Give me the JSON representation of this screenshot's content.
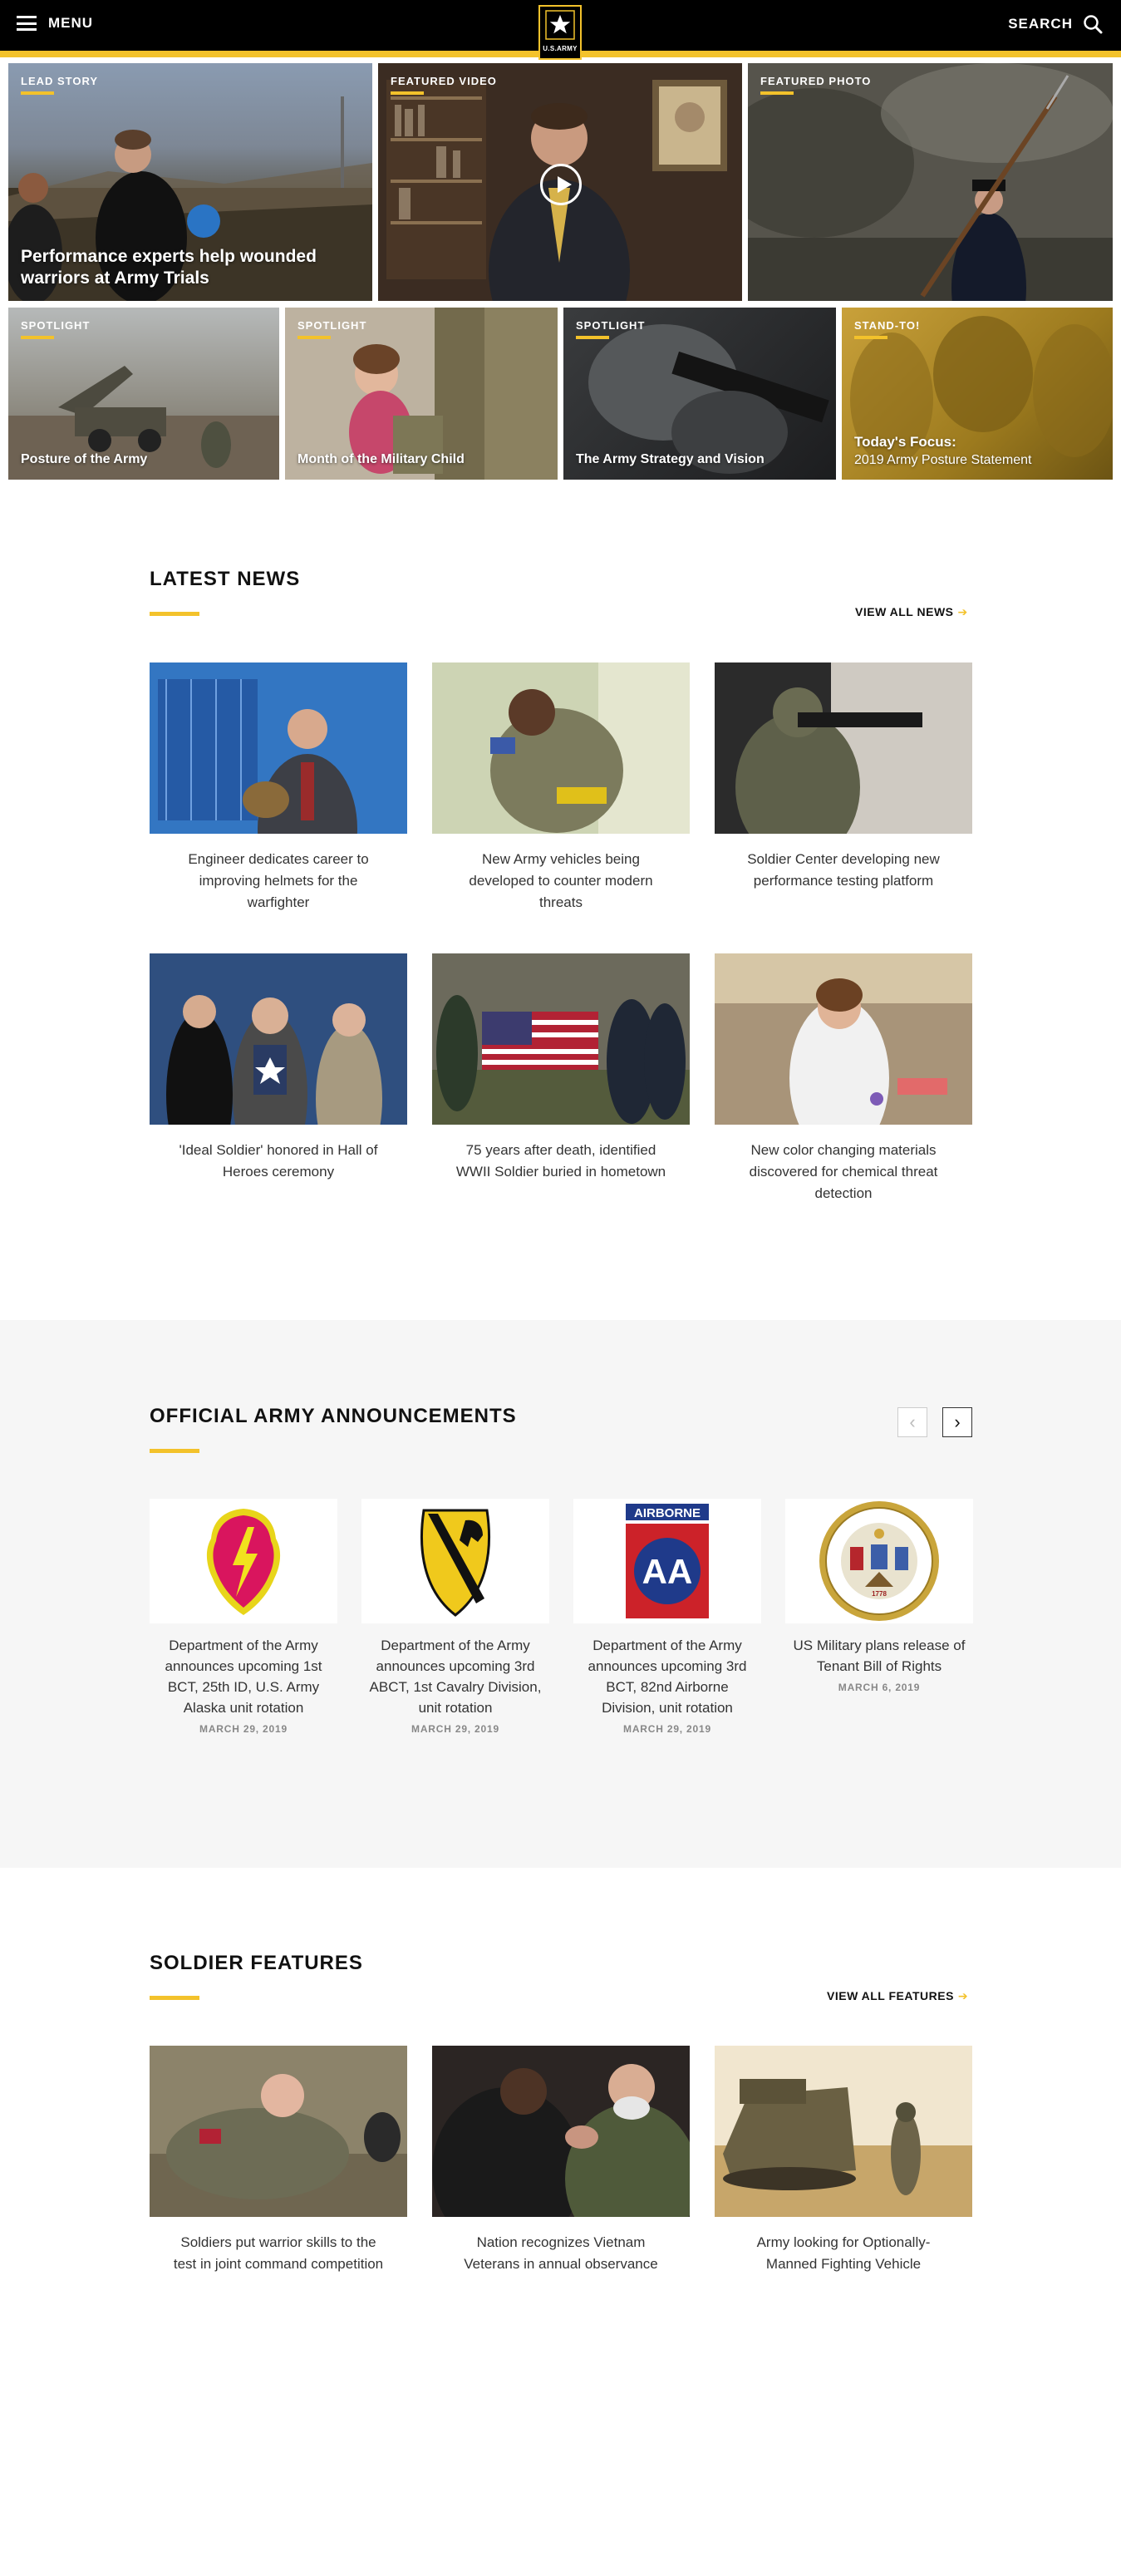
{
  "header": {
    "menu_label": "MENU",
    "search_label": "SEARCH",
    "logo_text": "U.S.ARMY",
    "accent_color": "#f3c22b"
  },
  "hero": {
    "lead": {
      "category": "LEAD STORY",
      "title": "Performance experts help wounded warriors at Army Trials"
    },
    "video": {
      "category": "FEATURED VIDEO"
    },
    "photo": {
      "category": "FEATURED PHOTO"
    },
    "spotlights": [
      {
        "category": "SPOTLIGHT",
        "title": "Posture of the Army"
      },
      {
        "category": "SPOTLIGHT",
        "title": "Month of the Military Child"
      },
      {
        "category": "SPOTLIGHT",
        "title": "The Army Strategy and Vision"
      }
    ],
    "standto": {
      "category": "STAND-TO!",
      "focus_label": "Today's Focus:",
      "focus_title": "2019 Army Posture Statement"
    }
  },
  "latest_news": {
    "title": "LATEST NEWS",
    "view_all": "VIEW ALL NEWS",
    "items": [
      {
        "caption": "Engineer dedicates career to improving helmets for the warfighter"
      },
      {
        "caption": "New Army vehicles being developed to counter modern threats"
      },
      {
        "caption": "Soldier Center developing new performance testing platform"
      },
      {
        "caption": "'Ideal Soldier' honored in Hall of Heroes ceremony"
      },
      {
        "caption": "75 years after death, identified WWII Soldier buried in hometown"
      },
      {
        "caption": "New color changing materials discovered for chemical threat detection"
      }
    ]
  },
  "announcements": {
    "title": "OFFICIAL ARMY ANNOUNCEMENTS",
    "prev_icon": "chevron-left-icon",
    "next_icon": "chevron-right-icon",
    "items": [
      {
        "title": "Department of the Army announces upcoming 1st BCT, 25th ID, U.S. Army Alaska unit rotation",
        "date": "MARCH 29, 2019",
        "logo": "25th-infantry-patch"
      },
      {
        "title": "Department of the Army announces upcoming 3rd ABCT, 1st Cavalry Division, unit rotation",
        "date": "MARCH 29, 2019",
        "logo": "1st-cavalry-patch"
      },
      {
        "title": "Department of the Army announces upcoming 3rd BCT, 82nd Airborne Division, unit rotation",
        "date": "MARCH 29, 2019",
        "logo": "82nd-airborne-patch",
        "logo_text": "AIRBORNE"
      },
      {
        "title": "US Military plans release of Tenant Bill of Rights",
        "date": "MARCH 6, 2019",
        "logo": "department-of-the-army-seal"
      }
    ]
  },
  "soldier_features": {
    "title": "SOLDIER FEATURES",
    "view_all": "VIEW ALL FEATURES",
    "items": [
      {
        "caption": "Soldiers put warrior skills to the test in joint command competition"
      },
      {
        "caption": "Nation recognizes Vietnam Veterans in annual observance"
      },
      {
        "caption": "Army looking for Optionally-Manned Fighting Vehicle"
      }
    ]
  }
}
